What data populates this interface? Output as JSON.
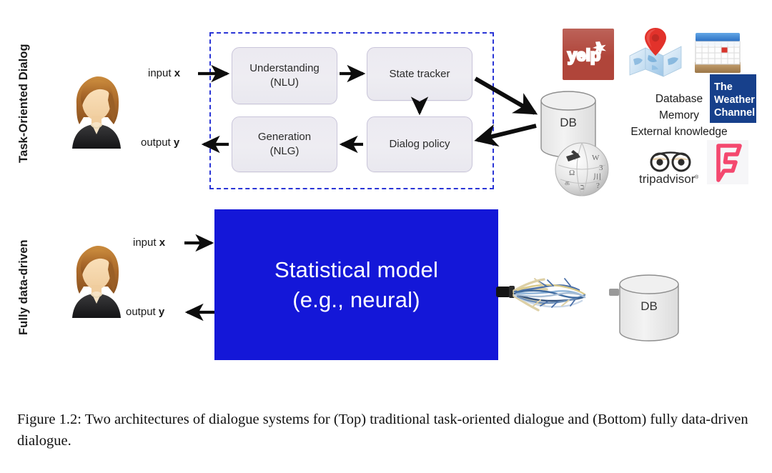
{
  "figure": {
    "caption_number": "Figure 1.2:",
    "caption_text": " Two architectures of dialogue systems for (Top) traditional task-oriented dialogue and (Bottom) fully data-driven dialogue."
  },
  "rows": {
    "top": {
      "label": "Task-Oriented Dialog"
    },
    "bottom": {
      "label": "Fully data-driven"
    }
  },
  "io": {
    "input_prefix": "input ",
    "input_symbol": "x",
    "output_prefix": "output ",
    "output_symbol": "y"
  },
  "pipeline": {
    "boxes": [
      {
        "name": "nlu",
        "line1": "Understanding",
        "line2": "(NLU)"
      },
      {
        "name": "state-tracker",
        "line1": "State tracker",
        "line2": ""
      },
      {
        "name": "nlg",
        "line1": "Generation",
        "line2": "(NLG)"
      },
      {
        "name": "dialog-policy",
        "line1": "Dialog policy",
        "line2": ""
      }
    ]
  },
  "statistical_model": {
    "line1": "Statistical model",
    "line2": "(e.g., neural)"
  },
  "database": {
    "label_top": "DB",
    "label_bottom": "DB"
  },
  "knowledge_sources": {
    "line1": "Database",
    "line2": "Memory",
    "line3": "External knowledge"
  },
  "logos": {
    "yelp": {
      "name": "yelp-logo",
      "text": "yelp"
    },
    "maps": {
      "name": "google-maps-logo"
    },
    "calendar": {
      "name": "calendar-icon"
    },
    "weather": {
      "name": "weather-channel-logo",
      "l1": "The",
      "l2": "Weather",
      "l3": "Channel"
    },
    "wikipedia": {
      "name": "wikipedia-globe-logo"
    },
    "tripadvisor": {
      "name": "tripadvisor-logo",
      "text": "tripadvisor"
    },
    "foursquare": {
      "name": "foursquare-logo"
    }
  },
  "colors": {
    "dashed_border": "#2a35d6",
    "model_blue": "#1417d8",
    "box_fill": "#eceaf1",
    "box_border": "#c9c5da",
    "yelp_red": "#b03a2e",
    "weather_blue": "#1b3f8b",
    "foursquare_pink": "#f2426d",
    "arrow_black": "#0d0d0d"
  }
}
